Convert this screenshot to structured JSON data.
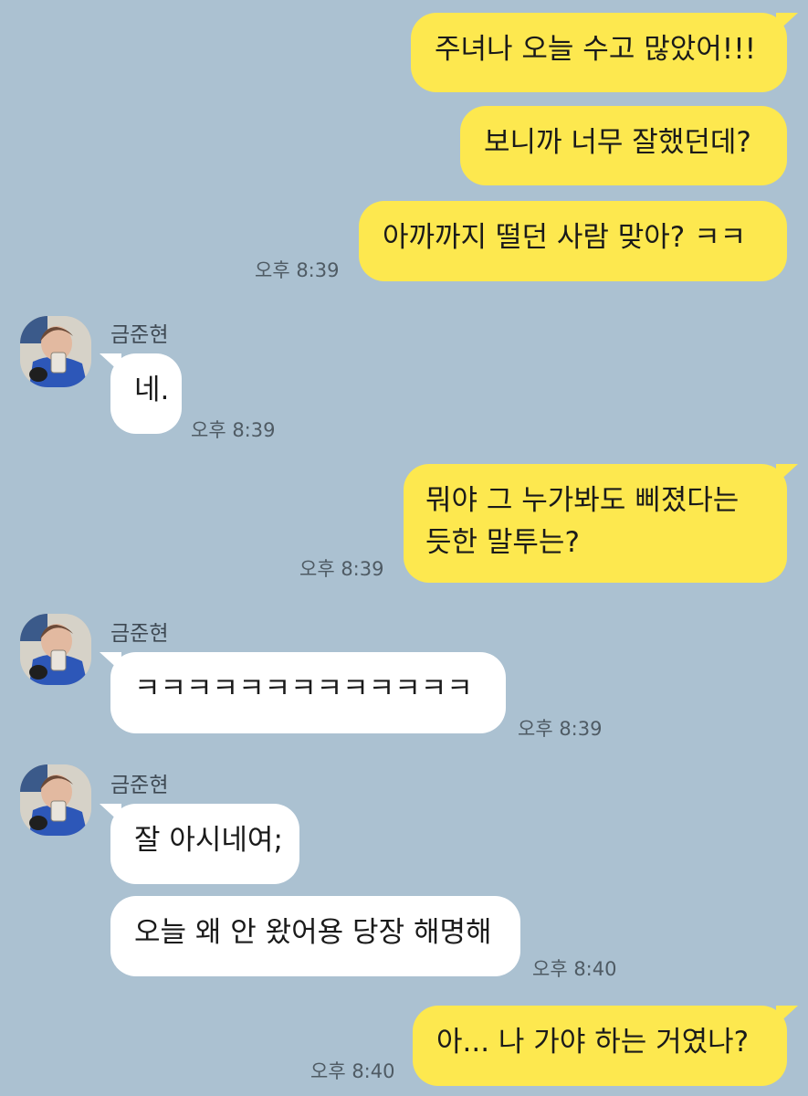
{
  "contact_name": "금준현",
  "messages": [
    {
      "text": "주녀나 오늘 수고 많았어!!!"
    },
    {
      "text": "보니까 너무 잘했던데?"
    },
    {
      "text": "아까까지 떨던 사람 맞아? ㅋㅋ",
      "time": "오후 8:39"
    },
    {
      "text": "네.",
      "time": "오후 8:39"
    },
    {
      "text": "뭐야 그 누가봐도 삐졌다는 듯한 말투는?",
      "time": "오후 8:39"
    },
    {
      "text": "ㅋㅋㅋㅋㅋㅋㅋㅋㅋㅋㅋㅋㅋ",
      "time": "오후 8:39"
    },
    {
      "text": "잘 아시네여;"
    },
    {
      "text": "오늘 왜 안 왔어용 당장 해명해",
      "time": "오후 8:40"
    },
    {
      "text": "아... 나 가야 하는 거였나?",
      "time": "오후 8:40"
    }
  ],
  "colors": {
    "background": "#abc1d1",
    "my_bubble": "#fde84f",
    "their_bubble": "#ffffff"
  }
}
